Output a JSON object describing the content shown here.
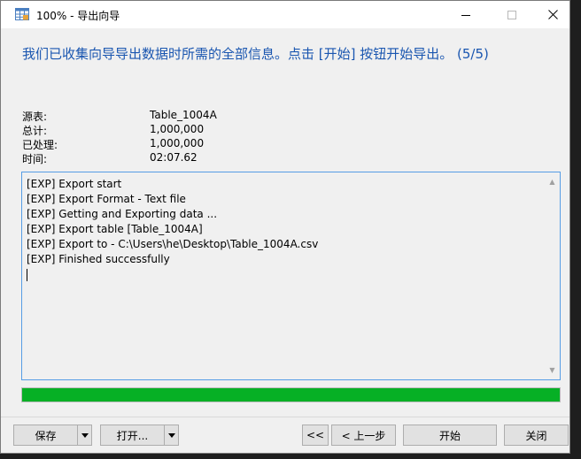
{
  "window": {
    "title": "100% - 导出向导"
  },
  "header": {
    "message": "我们已收集向导导出数据时所需的全部信息。点击 [开始] 按钮开始导出。 (5/5)"
  },
  "info": {
    "rows": [
      {
        "label": "源表:",
        "value": "Table_1004A"
      },
      {
        "label": "总计:",
        "value": "1,000,000"
      },
      {
        "label": "已处理:",
        "value": "1,000,000"
      },
      {
        "label": "时间:",
        "value": "02:07.62"
      }
    ]
  },
  "log": {
    "lines": [
      "[EXP] Export start",
      "[EXP] Export Format - Text file",
      "[EXP] Getting and Exporting data ...",
      "[EXP] Export table [Table_1004A]",
      "[EXP] Export to - C:\\Users\\he\\Desktop\\Table_1004A.csv",
      "[EXP] Finished successfully"
    ]
  },
  "progress": {
    "percent": 100,
    "color": "#06b025"
  },
  "buttons": {
    "save": "保存",
    "open": "打开...",
    "first": "<<",
    "back": "< 上一步",
    "start": "开始",
    "close": "关闭"
  },
  "colors": {
    "header": "#1a56b0",
    "log_border": "#569de5"
  }
}
